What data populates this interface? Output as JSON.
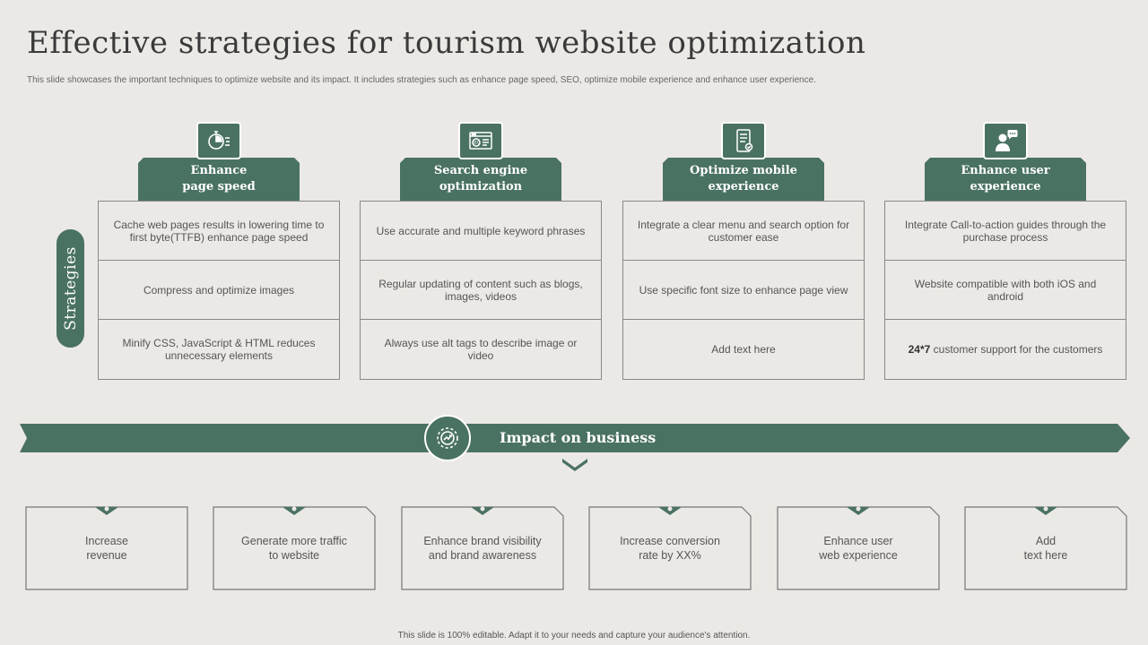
{
  "title": "Effective strategies for tourism website optimization",
  "subtitle": "This slide showcases the important techniques to optimize  website and its impact. It includes strategies such as enhance page speed, SEO, optimize mobile  experience and enhance user experience.",
  "strategies_label": "Strategies",
  "columns": [
    {
      "icon": "stopwatch-icon",
      "heading": "Enhance\npage speed",
      "items": [
        "Cache web pages results in lowering time to first byte(TTFB)  enhance page speed",
        "Compress and optimize images",
        "Minify CSS, JavaScript & HTML reduces unnecessary elements"
      ]
    },
    {
      "icon": "seo-browser-icon",
      "heading": "Search engine\noptimization",
      "items": [
        "Use accurate and multiple keyword phrases",
        "Regular updating of content such as blogs, images, videos",
        "Always use alt tags to describe image or video"
      ]
    },
    {
      "icon": "mobile-phone-icon",
      "heading": "Optimize mobile\nexperience",
      "items": [
        "Integrate a clear menu and search option for customer ease",
        "Use specific font size to enhance page view",
        "Add text here"
      ]
    },
    {
      "icon": "user-chat-icon",
      "heading": "Enhance user\nexperience",
      "items": [
        "Integrate Call-to-action guides through the purchase process",
        "Website compatible with both iOS and android",
        "customer support for the customers"
      ],
      "last_item_bold": "24*7"
    }
  ],
  "impact": {
    "title": "Impact on business",
    "icon": "gear-growth-icon",
    "cards": [
      "Increase\nrevenue",
      "Generate  more traffic\nto website",
      "Enhance brand visibility\nand brand awareness",
      "Increase conversion\nrate by XX%",
      "Enhance user\nweb experience",
      "Add\ntext here"
    ]
  },
  "footer": "This slide is 100% editable.  Adapt it to your needs and capture your audience's attention.",
  "colors": {
    "accent": "#4a7262",
    "background": "#ebe9e5",
    "border": "#888888"
  }
}
